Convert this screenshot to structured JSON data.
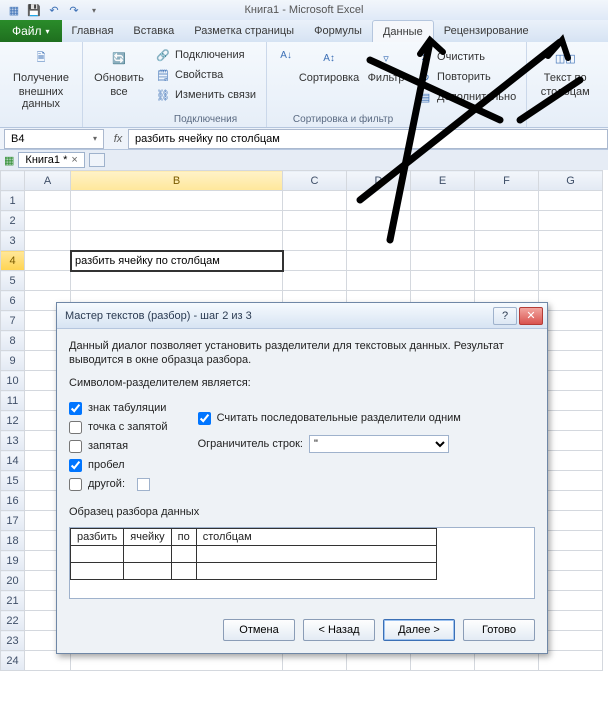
{
  "app": {
    "title": "Книга1 - Microsoft Excel"
  },
  "qat": {
    "save": "save-icon",
    "undo": "undo-icon",
    "redo": "redo-icon"
  },
  "tabs": {
    "file": "Файл",
    "items": [
      "Главная",
      "Вставка",
      "Разметка страницы",
      "Формулы",
      "Данные",
      "Рецензирование"
    ],
    "active": "Данные"
  },
  "ribbon": {
    "group1": {
      "title": "",
      "btn1_l1": "Получение",
      "btn1_l2": "внешних данных"
    },
    "group2": {
      "title": "Подключения",
      "refresh_l1": "Обновить",
      "refresh_l2": "все",
      "mini1": "Подключения",
      "mini2": "Свойства",
      "mini3": "Изменить связи"
    },
    "group3": {
      "title": "Сортировка и фильтр",
      "sort": "Сортировка",
      "filter": "Фильтр",
      "mini1": "Очистить",
      "mini2": "Повторить",
      "mini3": "Дополнительно"
    },
    "group4": {
      "btn_l1": "Текст по",
      "btn_l2": "столбцам"
    }
  },
  "namebox": "B4",
  "formula": "разбить ячейку по столбцам",
  "workbook": {
    "tab": "Книга1 *"
  },
  "columns": [
    "A",
    "B",
    "C",
    "D",
    "E",
    "F",
    "G"
  ],
  "rows": [
    "1",
    "2",
    "3",
    "4",
    "5",
    "6",
    "7",
    "8",
    "9",
    "10",
    "11",
    "12",
    "13",
    "14",
    "15",
    "16",
    "17",
    "18",
    "19",
    "20",
    "21",
    "22",
    "23",
    "24"
  ],
  "cell_b4": "разбить ячейку по столбцам",
  "dialog": {
    "title": "Мастер текстов (разбор) - шаг 2 из 3",
    "desc": "Данный диалог позволяет установить разделители для текстовых данных. Результат выводится в окне образца разбора.",
    "sym_label": "Символом-разделителем является:",
    "chk_tab": "знак табуляции",
    "chk_semicolon": "точка с запятой",
    "chk_comma": "запятая",
    "chk_space": "пробел",
    "chk_other": "другой:",
    "chk_tab_checked": true,
    "chk_semicolon_checked": false,
    "chk_comma_checked": false,
    "chk_space_checked": true,
    "chk_other_checked": false,
    "consecutive": "Считать последовательные разделители одним",
    "consecutive_checked": true,
    "qualifier_label": "Ограничитель строк:",
    "qualifier_value": "\"",
    "preview_label": "Образец разбора данных",
    "preview_cols": [
      "разбить",
      "ячейку",
      "по",
      "столбцам"
    ],
    "btn_cancel": "Отмена",
    "btn_back": "< Назад",
    "btn_next": "Далее >",
    "btn_finish": "Готово"
  }
}
